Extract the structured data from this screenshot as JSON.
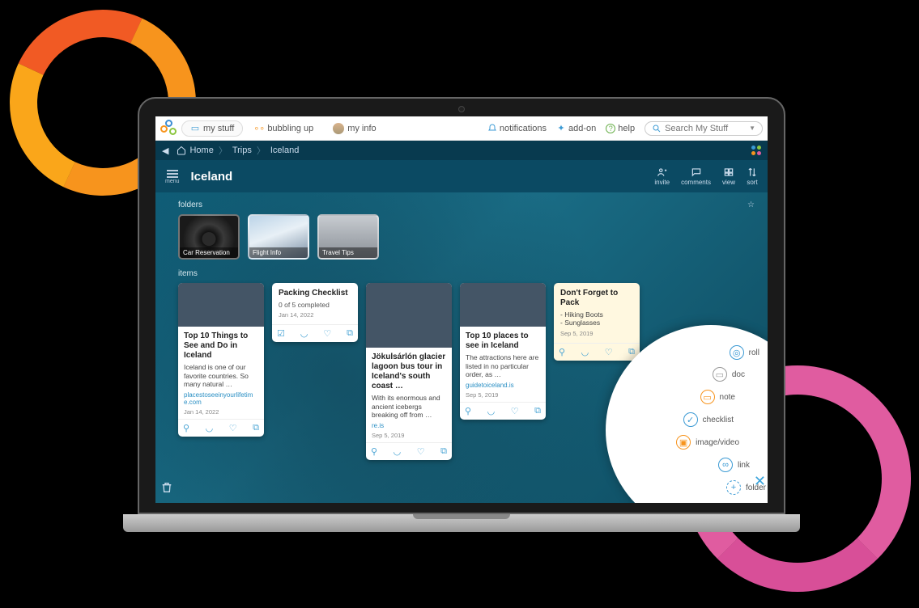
{
  "nav": {
    "mystuff": "my stuff",
    "bubbling": "bubbling up",
    "myinfo": "my info",
    "notifications": "notifications",
    "addon": "add-on",
    "help": "help",
    "search_placeholder": "Search My Stuff"
  },
  "breadcrumb": {
    "home": "Home",
    "trips": "Trips",
    "iceland": "Iceland"
  },
  "title": "Iceland",
  "menu_label": "menu",
  "actions": {
    "invite": "invite",
    "comments": "comments",
    "view": "view",
    "sort": "sort"
  },
  "section": {
    "folders": "folders",
    "items": "items"
  },
  "folders": [
    {
      "label": "Car Reservation"
    },
    {
      "label": "Flight Info"
    },
    {
      "label": "Travel Tips"
    }
  ],
  "cards": {
    "c1": {
      "title": "Top 10 Things to See and Do in Iceland",
      "desc": "Iceland is one of our favorite countries. So many natural …",
      "link": "placestoseeinyourlifetime.com",
      "date": "Jan 14, 2022"
    },
    "c2": {
      "title": "Packing Checklist",
      "sub": "0 of 5 completed",
      "date": "Jan 14, 2022"
    },
    "c3": {
      "title": "Jökulsárlón glacier lagoon bus tour in Iceland's south coast …",
      "desc": "With its enormous and ancient icebergs breaking off from …",
      "link": "re.is",
      "date": "Sep 5, 2019"
    },
    "c4": {
      "title": "Top 10 places to see in Iceland",
      "desc": "The attractions here are listed in no particular order, as …",
      "link": "guidetoiceland.is",
      "date": "Sep 5, 2019"
    },
    "c5": {
      "title": "Don't Forget to Pack",
      "i1": "Hiking Boots",
      "i2": "Sunglasses",
      "date": "Sep 5, 2019"
    }
  },
  "radial": {
    "roll": "roll",
    "doc": "doc",
    "note": "note",
    "checklist": "checklist",
    "imagevideo": "image/video",
    "link": "link",
    "folder": "folder"
  }
}
